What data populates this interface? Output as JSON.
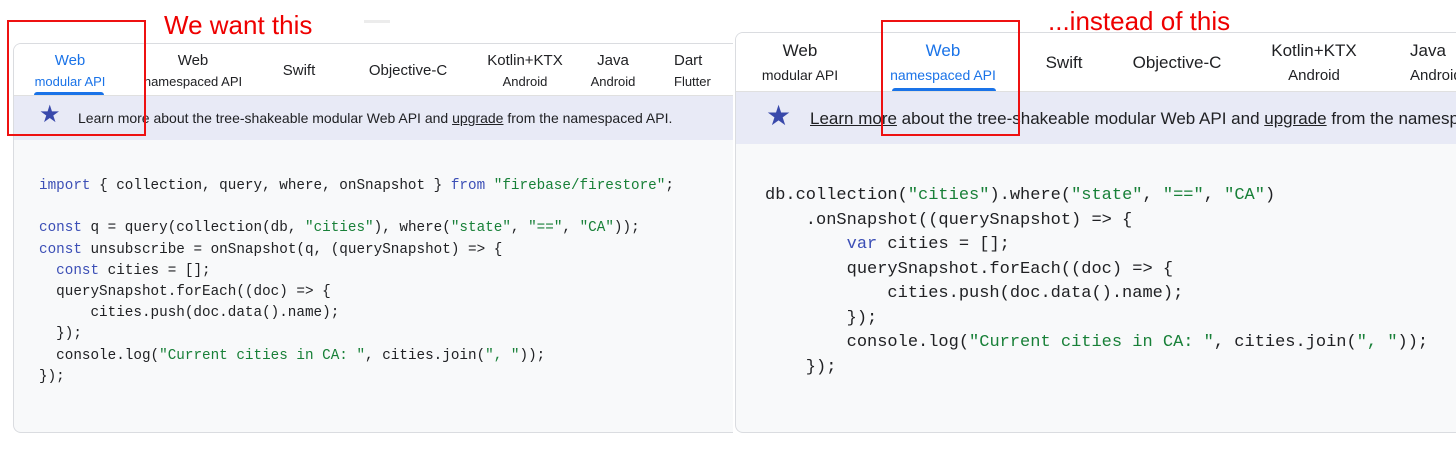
{
  "annotations": {
    "left_caption": "We want this",
    "right_caption": "...instead of this"
  },
  "colors": {
    "annotation_red": "#ee0000",
    "active_tab_blue": "#1a73e8",
    "keyword_blue": "#3c4fb6",
    "string_green": "#188038",
    "notice_bg": "#e8eaf6",
    "star_color": "#3949ab",
    "code_bg": "#f8f9fa"
  },
  "left": {
    "tabs": [
      {
        "line1": "Web",
        "line2": "modular API",
        "active": true
      },
      {
        "line1": "Web",
        "line2": "namespaced API",
        "active": false
      },
      {
        "line1": "Swift",
        "line2": "",
        "active": false
      },
      {
        "line1": "Objective-C",
        "line2": "",
        "active": false
      },
      {
        "line1": "Kotlin+KTX",
        "line2": "Android",
        "active": false
      },
      {
        "line1": "Java",
        "line2": "Android",
        "active": false
      },
      {
        "line1": "Dart",
        "line2": "Flutter",
        "active": false
      }
    ],
    "notice": {
      "icon": "star-icon",
      "part1": "Learn more about the tree-shakeable modular Web API and ",
      "link": "upgrade",
      "part2": " from the namespaced API."
    },
    "code": {
      "line1": {
        "kw1": "import",
        "mid1": " { collection, query, where, onSnapshot } ",
        "kw2": "from",
        "sp": " ",
        "str1": "\"firebase/firestore\"",
        "end": ";"
      },
      "line3": {
        "kw1": "const",
        "mid1": " q = query(collection(db, ",
        "str1": "\"cities\"",
        "mid2": "), where(",
        "str2": "\"state\"",
        "c1": ", ",
        "str3": "\"==\"",
        "c2": ", ",
        "str4": "\"CA\"",
        "end": "));"
      },
      "line4": {
        "kw1": "const",
        "mid1": " unsubscribe = onSnapshot(q, (querySnapshot) => {"
      },
      "line5": {
        "indent": "  ",
        "kw1": "const",
        "mid1": " cities = [];"
      },
      "line6": {
        "text": "  querySnapshot.forEach((doc) => {"
      },
      "line7": {
        "text": "      cities.push(doc.data().name);"
      },
      "line8": {
        "text": "  });"
      },
      "line9": {
        "pre": "  console.log(",
        "str1": "\"Current cities in CA: \"",
        "mid": ", cities.join(",
        "str2": "\", \"",
        "end": "));"
      },
      "line10": {
        "text": "});"
      }
    }
  },
  "right": {
    "tabs": [
      {
        "line1": "Web",
        "line2": "modular API",
        "active": false
      },
      {
        "line1": "Web",
        "line2": "namespaced API",
        "active": true
      },
      {
        "line1": "Swift",
        "line2": "",
        "active": false
      },
      {
        "line1": "Objective-C",
        "line2": "",
        "active": false
      },
      {
        "line1": "Kotlin+KTX",
        "line2": "Android",
        "active": false
      },
      {
        "line1": "Java",
        "line2": "Android",
        "active": false
      }
    ],
    "notice": {
      "icon": "star-icon",
      "link1": "Learn more",
      "part1": " about the tree-shakeable modular Web API and ",
      "link2": "upgrade",
      "part2": " from the namespaced API."
    },
    "code": {
      "line1": {
        "pre": "db.collection(",
        "str1": "\"cities\"",
        "mid1": ").where(",
        "str2": "\"state\"",
        "c1": ", ",
        "str3": "\"==\"",
        "c2": ", ",
        "str4": "\"CA\"",
        "end": ")"
      },
      "line2": {
        "text": "    .onSnapshot((querySnapshot) => {"
      },
      "line3": {
        "indent": "        ",
        "kw1": "var",
        "mid1": " cities = [];"
      },
      "line4": {
        "text": "        querySnapshot.forEach((doc) => {"
      },
      "line5": {
        "text": "            cities.push(doc.data().name);"
      },
      "line6": {
        "text": "        });"
      },
      "line7": {
        "pre": "        console.log(",
        "str1": "\"Current cities in CA: \"",
        "mid": ", cities.join(",
        "str2": "\", \"",
        "end": "));"
      },
      "line8": {
        "text": "    });"
      }
    }
  }
}
